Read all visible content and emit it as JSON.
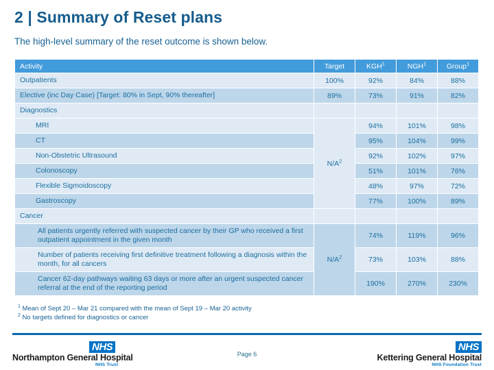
{
  "slide": {
    "title": "2 | Summary of Reset plans",
    "subtitle": "The high-level summary of the reset outcome is shown below.",
    "page_label": "Page 6"
  },
  "theme": {
    "header_blue": "#429bdb",
    "title_blue": "#155c8c",
    "text_blue": "#1b6e9e",
    "row_light": "#dfeaf5",
    "row_dark": "#bdd6ea",
    "na_cell": "#e6eff8",
    "rule_blue": "#0a66ab",
    "nhs_blue": "#0072c6"
  },
  "table": {
    "headers": {
      "activity": "Activity",
      "target": "Target",
      "kgh": "KGH",
      "kgh_sup": "1",
      "ngh": "NGH",
      "ngh_sup": "1",
      "group": "Group",
      "group_sup": "1"
    },
    "na_label": "N/A",
    "na_sup": "2",
    "rows": [
      {
        "label": "Outpatients",
        "target": "100%",
        "kgh": "92%",
        "ngh": "84%",
        "group": "88%"
      },
      {
        "label": "Elective (inc Day Case)  [Target: 80% in Sept, 90% thereafter]",
        "target": "89%",
        "kgh": "73%",
        "ngh": "91%",
        "group": "82%"
      },
      {
        "label": "Diagnostics",
        "target": "",
        "kgh": "",
        "ngh": "",
        "group": ""
      },
      {
        "label": "MRI",
        "target": "",
        "kgh": "94%",
        "ngh": "101%",
        "group": "98%"
      },
      {
        "label": "CT",
        "target": "",
        "kgh": "95%",
        "ngh": "104%",
        "group": "99%"
      },
      {
        "label": "Non-Obstetric Ultrasound",
        "target": "",
        "kgh": "92%",
        "ngh": "102%",
        "group": "97%"
      },
      {
        "label": "Colonoscopy",
        "target": "",
        "kgh": "51%",
        "ngh": "101%",
        "group": "76%"
      },
      {
        "label": "Flexible Sigmoidoscopy",
        "target": "",
        "kgh": "48%",
        "ngh": "97%",
        "group": "72%"
      },
      {
        "label": "Gastroscopy",
        "target": "",
        "kgh": "77%",
        "ngh": "100%",
        "group": "89%"
      },
      {
        "label": "Cancer",
        "target": "",
        "kgh": "",
        "ngh": "",
        "group": ""
      },
      {
        "label": "All patients urgently referred with suspected cancer by their GP who received a first outpatient appointment in the given month",
        "target": "",
        "kgh": "74%",
        "ngh": "119%",
        "group": "96%"
      },
      {
        "label": "Number of patients receiving first definitive treatment following a diagnosis within the month, for all cancers",
        "target": "",
        "kgh": "73%",
        "ngh": "103%",
        "group": "88%"
      },
      {
        "label": "Cancer 62-day pathways waiting 63 days or more after an urgent suspected cancer referral at the end of the reporting period",
        "target": "",
        "kgh": "190%",
        "ngh": "270%",
        "group": "230%"
      }
    ]
  },
  "footnotes": [
    {
      "marker": "1",
      "text": "Mean of Sept 20 – Mar 21 compared with the mean of Sept 19 – Mar 20 activity"
    },
    {
      "marker": "2",
      "text": "No targets defined for diagnostics or cancer"
    }
  ],
  "footer": {
    "left_logo": {
      "badge": "NHS",
      "trust_name": "Northampton General Hospital",
      "trust_sub": "NHS Trust"
    },
    "right_logo": {
      "badge": "NHS",
      "trust_name": "Kettering General Hospital",
      "trust_sub": "NHS Foundation Trust"
    }
  }
}
